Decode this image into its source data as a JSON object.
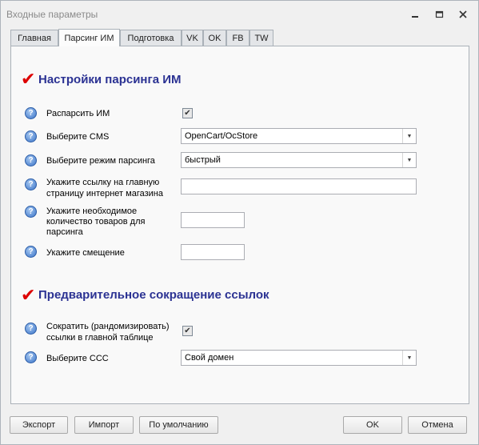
{
  "window": {
    "title": "Входные параметры"
  },
  "tabs": [
    {
      "label": "Главная"
    },
    {
      "label": "Парсинг ИМ"
    },
    {
      "label": "Подготовка"
    },
    {
      "label": "VK"
    },
    {
      "label": "OK"
    },
    {
      "label": "FB"
    },
    {
      "label": "TW"
    }
  ],
  "active_tab": "Парсинг ИМ",
  "section1": {
    "title": "Настройки парсинга ИМ",
    "parse_label": "Распарсить ИМ",
    "parse_checked": true,
    "cms_label": "Выберите CMS",
    "cms_value": "OpenCart/OcStore",
    "mode_label": "Выберите режим парсинга",
    "mode_value": "быстрый",
    "url_label_1": "Укажите ссылку на главную",
    "url_label_2": "страницу интернет магазина",
    "url_value": "",
    "count_label_1": "Укажите необходимое",
    "count_label_2": "количество товаров для",
    "count_label_3": "парсинга",
    "count_value": "",
    "offset_label": "Укажите смещение",
    "offset_value": ""
  },
  "section2": {
    "title": "Предварительное сокращение ссылок",
    "shorten_label_1": "Сократить (рандомизировать)",
    "shorten_label_2": "ссылки в главной таблице",
    "shorten_checked": true,
    "ccc_label": "Выберите ССС",
    "ccc_value": "Свой домен"
  },
  "buttons": {
    "export": "Экспорт",
    "import": "Импорт",
    "default": "По умолчанию",
    "ok": "OK",
    "cancel": "Отмена"
  }
}
